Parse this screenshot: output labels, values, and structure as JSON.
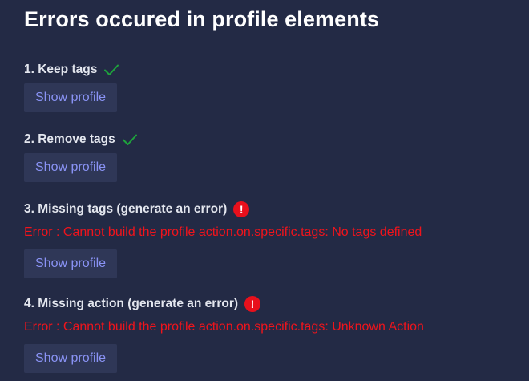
{
  "title": "Errors occured in profile elements",
  "colors": {
    "background": "#232a45",
    "button_bg": "#2f3757",
    "button_text": "#8a93f5",
    "success": "#1ea33c",
    "error": "#f0141c"
  },
  "items": [
    {
      "label": "1. Keep tags",
      "status": "success",
      "status_icon": "checkmark-icon",
      "button_label": "Show profile"
    },
    {
      "label": "2. Remove tags",
      "status": "success",
      "status_icon": "checkmark-icon",
      "button_label": "Show profile"
    },
    {
      "label": "3. Missing tags (generate an error)",
      "status": "error",
      "status_icon": "error-alert-icon",
      "error_message": "Error : Cannot build the profile action.on.specific.tags: No tags defined",
      "button_label": "Show profile"
    },
    {
      "label": "4. Missing action (generate an error)",
      "status": "error",
      "status_icon": "error-alert-icon",
      "error_message": "Error : Cannot build the profile action.on.specific.tags: Unknown Action",
      "button_label": "Show profile"
    }
  ],
  "error_icon_glyph": "!"
}
